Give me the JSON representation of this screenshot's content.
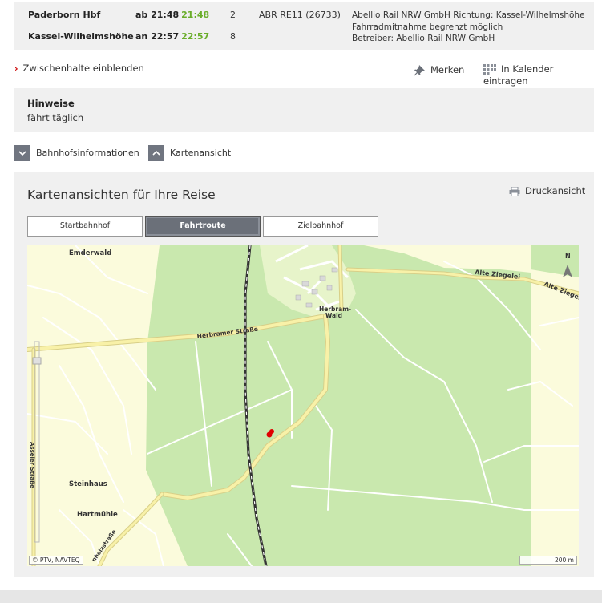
{
  "connection": {
    "departure": {
      "station": "Paderborn Hbf",
      "time_label": "ab 21:48",
      "realtime": "21:48",
      "platform": "2",
      "train": "ABR RE11 (26733)"
    },
    "arrival": {
      "station": "Kassel-Wilhelmshöhe",
      "time_label": "an 22:57",
      "realtime": "22:57",
      "platform": "8"
    },
    "info_lines": [
      "Abellio Rail NRW GmbH Richtung: Kassel-Wilhelmshöhe",
      "Fahrradmitnahme begrenzt möglich",
      "Betreiber: Abellio Rail NRW GmbH"
    ]
  },
  "actions": {
    "zwischenhalte": "Zwischenhalte einblenden",
    "merken": "Merken",
    "kalender": "In Kalender eintragen"
  },
  "hinweise": {
    "heading": "Hinweise",
    "text": "fährt täglich"
  },
  "toggles": {
    "bahnhofsinfo": "Bahnhofsinformationen",
    "kartenansicht": "Kartenansicht"
  },
  "map_panel": {
    "title": "Kartenansichten für Ihre Reise",
    "druckansicht": "Druckansicht",
    "tabs": [
      {
        "label": "Startbahnhof",
        "active": false
      },
      {
        "label": "Fahrtroute",
        "active": true
      },
      {
        "label": "Zielbahnhof",
        "active": false
      }
    ]
  },
  "map": {
    "labels": {
      "emderwald": "Emderwald",
      "alte_ziegelei_1": "Alte Ziegelei",
      "alte_ziegelei_2": "Alte Ziegel",
      "herbram_1": "Herbram-",
      "herbram_2": "Wald",
      "herbramer_strasse": "Herbramer Straße",
      "asseler_strasse": "Asseler Straße",
      "steinhaus": "Steinhaus",
      "hartmuehle": "Hartmühle",
      "holzstrasse": "nholzstraße",
      "north": "N"
    },
    "copyright": "© PTV, NAVTEQ",
    "scale": "200 m",
    "colors": {
      "forest": "#c9e8ae",
      "field": "#fbfbdc",
      "road_main": "#f8f1a8",
      "accent_green": "#6aad2a"
    }
  }
}
